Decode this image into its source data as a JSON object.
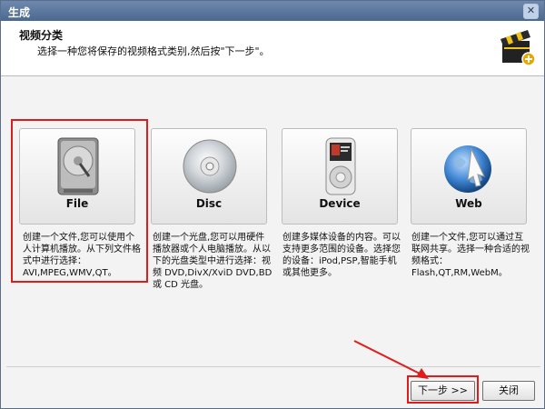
{
  "window": {
    "title": "生成",
    "close_glyph": "✕"
  },
  "header": {
    "title": "视频分类",
    "description": "选择一种您将保存的视频格式类别,然后按\"下一步\"。"
  },
  "cards": [
    {
      "label": "File",
      "icon": "hard-drive-icon",
      "description": "创建一个文件,您可以使用个人计算机播放。从下列文件格式中进行选择：AVI,MPEG,WMV,QT。"
    },
    {
      "label": "Disc",
      "icon": "disc-icon",
      "description": "创建一个光盘,您可以用硬件播放器或个人电脑播放。从以下的光盘类型中进行选择：视频 DVD,DivX/XviD DVD,BD 或 CD 光盘。"
    },
    {
      "label": "Device",
      "icon": "media-player-icon",
      "description": "创建多媒体设备的内容。可以支持更多范围的设备。选择您的设备：iPod,PSP,智能手机或其他更多。"
    },
    {
      "label": "Web",
      "icon": "globe-icon",
      "description": "创建一个文件,您可以通过互联网共享。选择一种合适的视频格式：Flash,QT,RM,WebM。"
    }
  ],
  "buttons": {
    "next": "下一步 >>",
    "close": "关闭"
  },
  "colors": {
    "highlight": "#e01b1b",
    "titlebar": "#4b6890"
  }
}
